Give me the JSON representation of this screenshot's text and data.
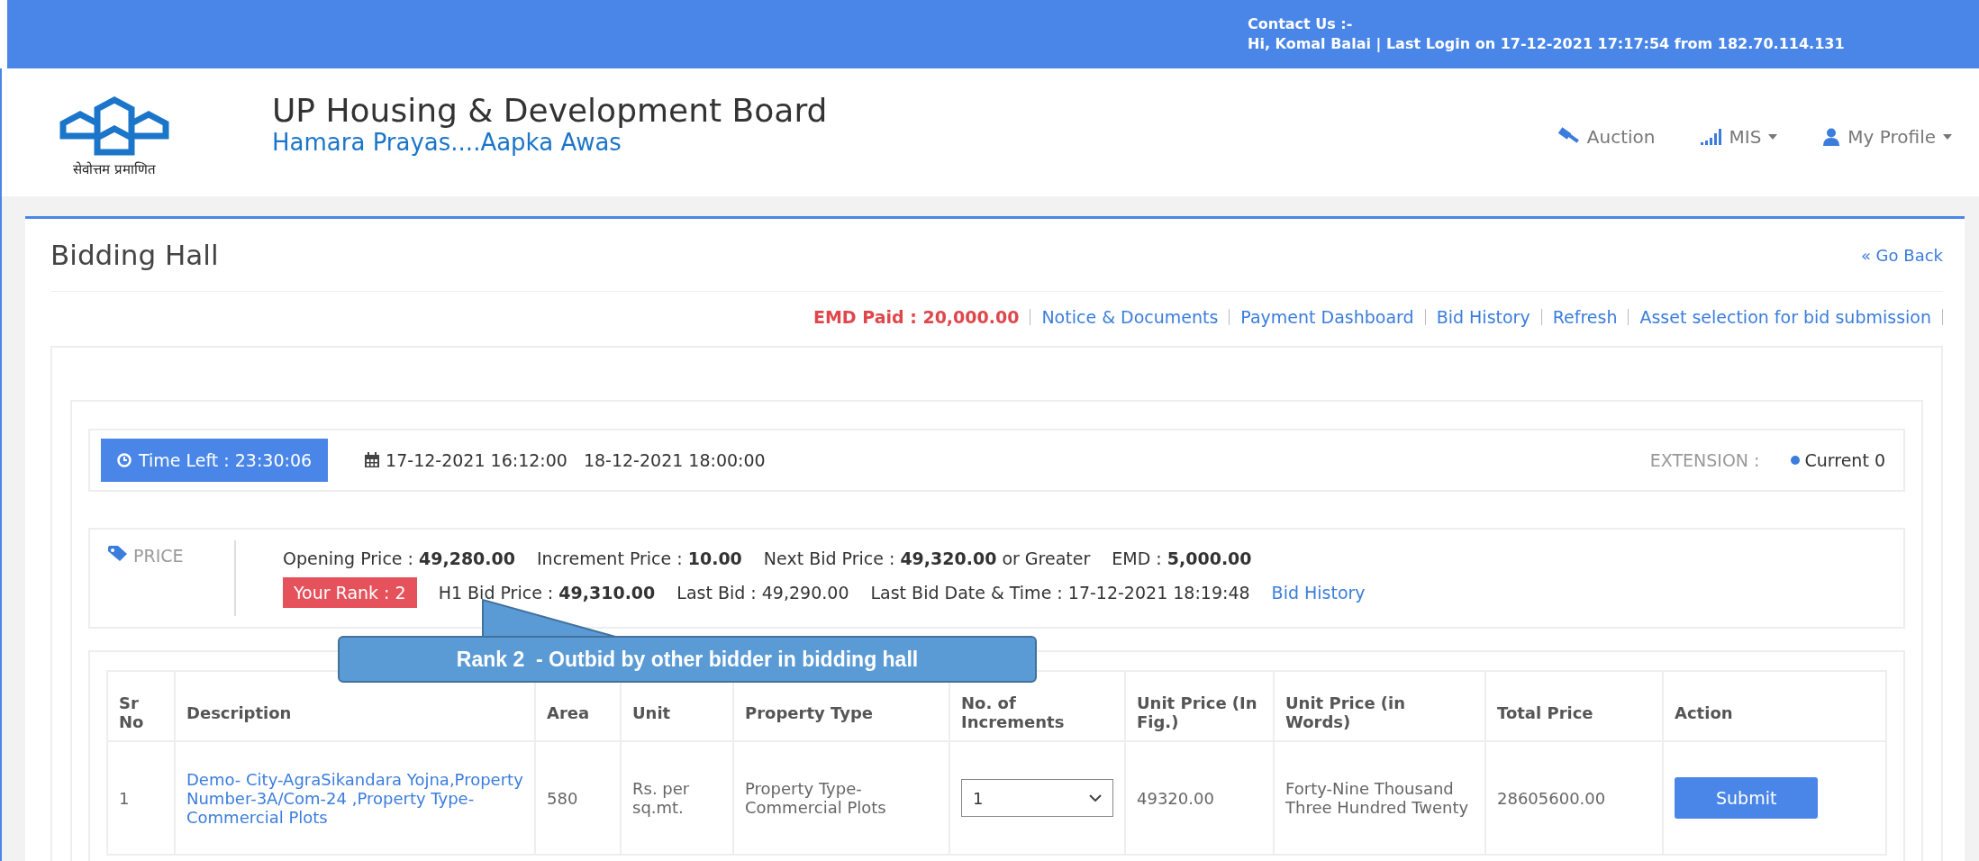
{
  "top_bar": {
    "contact": "Contact Us :-",
    "login_info": "Hi, Komal Balai | Last Login on 17-12-2021 17:17:54 from 182.70.114.131"
  },
  "header": {
    "logo_caption": "सेवोत्तम प्रमाणित",
    "title": "UP Housing & Development Board",
    "tagline": "Hamara Prayas....Aapka Awas",
    "nav": [
      {
        "label": "Auction",
        "dropdown": false
      },
      {
        "label": "MIS",
        "dropdown": true
      },
      {
        "label": "My Profile",
        "dropdown": true
      }
    ]
  },
  "page": {
    "title": "Bidding Hall",
    "back_link": "« Go Back"
  },
  "emd_paid": "EMD Paid : 20,000.00",
  "links": [
    "Notice & Documents",
    "Payment Dashboard",
    "Bid History",
    "Refresh",
    "Asset selection for bid submission"
  ],
  "timer": {
    "time_left": "Time Left : 23:30:06",
    "start": "17-12-2021 16:12:00",
    "end": "18-12-2021 18:00:00",
    "extension_label": "EXTENSION :",
    "extension_value": "Current 0"
  },
  "price": {
    "label": "PRICE",
    "line_1": [
      "Opening Price : **49,280.00**",
      "Increment Price : **10.00**",
      "Next Bid Price : **49,320.00** or Greater",
      "EMD : **5,000.00**"
    ],
    "rank": "Your Rank : 2",
    "line_2": [
      "H1 Bid Price : **49,310.00**",
      "Last Bid : 49,290.00",
      "Last Bid Date & Time : 17-12-2021 18:19:48"
    ],
    "history_link": "Bid History"
  },
  "callout": "Rank 2  - Outbid by other bidder in bidding hall",
  "table": {
    "columns": [
      "Sr No",
      "Description",
      "Area",
      "Unit",
      "Property Type",
      "No. of Increments",
      "Unit Price (In Fig.)",
      "Unit Price (in Words)",
      "Total Price",
      "Action"
    ],
    "rows": [
      {
        "sr": "1",
        "description": "Demo- City-AgraSikandara Yojna,Property Number-3A/Com-24 ,Property Type-Commercial Plots",
        "area": "580",
        "unit": "Rs. per sq.mt.",
        "property_type": "Property Type-Commercial Plots",
        "increments": "1",
        "unit_price": "49320.00",
        "unit_price_words": "Forty-Nine Thousand Three Hundred Twenty",
        "total_price": "28605600.00",
        "action": "Submit"
      }
    ]
  }
}
